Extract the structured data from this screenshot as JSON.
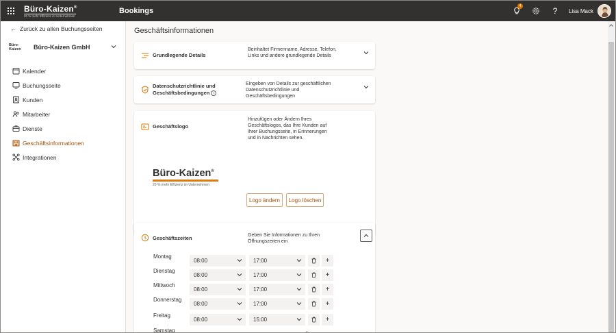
{
  "topbar": {
    "brand_name": "Büro-Kaizen",
    "brand_reg": "®",
    "brand_tagline": "20 % mehr Effizienz im Unternehmen",
    "app_title": "Bookings",
    "notification_count": "4",
    "user_name": "Lisa Mack"
  },
  "sidebar": {
    "back_label": "Zurück zu allen Buchungsseiten",
    "business_logo_text": "Büro-Kaizen",
    "business_name": "Büro-Kaizen GmbH",
    "items": [
      {
        "label": "Kalender",
        "icon": "calendar-icon"
      },
      {
        "label": "Buchungsseite",
        "icon": "monitor-icon"
      },
      {
        "label": "Kunden",
        "icon": "contact-card-icon"
      },
      {
        "label": "Mitarbeiter",
        "icon": "people-icon"
      },
      {
        "label": "Dienste",
        "icon": "briefcase-icon"
      },
      {
        "label": "Geschäftsinformationen",
        "icon": "building-icon",
        "active": true
      },
      {
        "label": "Integrationen",
        "icon": "integrations-icon"
      }
    ]
  },
  "main": {
    "page_title": "Geschäftsinformationen",
    "basic_details": {
      "title": "Grundlegende Details",
      "description": "Beinhaltet Firmenname, Adresse, Telefon, Links und andere grundlegende Details"
    },
    "privacy": {
      "title": "Datenschutzrichtlinie und Geschäftsbedingungen",
      "description": "Eingeben von Details zur geschäftlichen Datenschutzrichtlinie und Geschäftsbedingungen"
    },
    "logo": {
      "title": "Geschäftslogo",
      "description": "Hinzufügen oder Ändern Ihres Geschäftslogos, das Ihre Kunden auf Ihrer Buchungsseite, in Erinnerungen und in Nachrichten sehen.",
      "preview_name": "Büro-Kaizen",
      "preview_reg": "®",
      "preview_tagline": "20 % mehr Effizienz im Unternehmen",
      "change_label": "Logo ändern",
      "delete_label": "Logo löschen"
    },
    "hours": {
      "title": "Geschäftszeiten",
      "description": "Geben Sie Informationen zu Ihren Öffnungszeiten ein",
      "days": [
        {
          "day": "Montag",
          "start": "08:00",
          "end": "17:00"
        },
        {
          "day": "Dienstag",
          "start": "08:00",
          "end": "17:00"
        },
        {
          "day": "Mittwoch",
          "start": "08:00",
          "end": "17:00"
        },
        {
          "day": "Donnerstag",
          "start": "08:00",
          "end": "17:00"
        },
        {
          "day": "Freitag",
          "start": "08:00",
          "end": "15:00"
        },
        {
          "day": "Samstag",
          "start": "",
          "end": ""
        }
      ]
    }
  },
  "colors": {
    "accent": "#a0520c",
    "brand_orange": "#e07a10",
    "topbar": "#323130"
  }
}
